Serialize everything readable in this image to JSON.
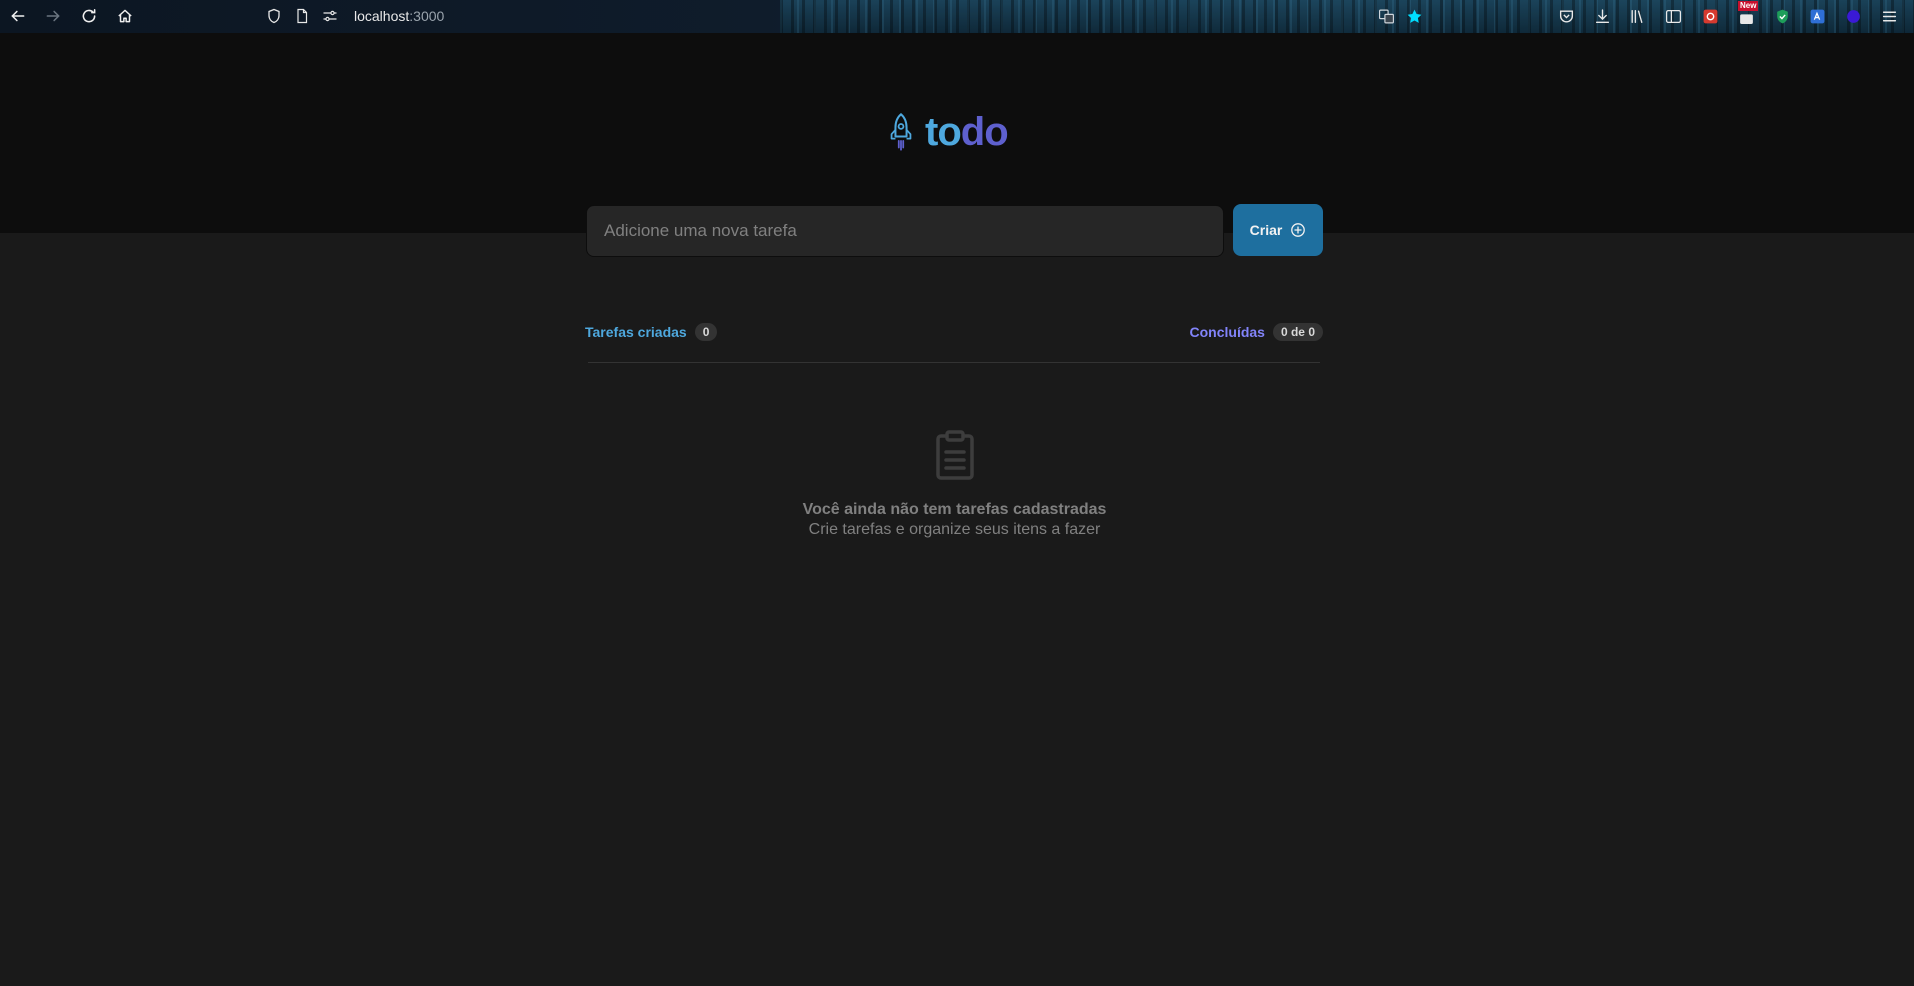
{
  "browser": {
    "url_host": "localhost",
    "url_port": ":3000",
    "badge_new": "New"
  },
  "app": {
    "logo_part1": "to",
    "logo_part2": "do",
    "input_placeholder": "Adicione uma nova tarefa",
    "create_label": "Criar",
    "created_label": "Tarefas criadas",
    "created_count": "0",
    "done_label": "Concluídas",
    "done_count": "0 de 0",
    "empty_title": "Você ainda não tem tarefas cadastradas",
    "empty_subtitle": "Crie tarefas e organize seus itens a fazer"
  },
  "colors": {
    "blue": "#4ea8de",
    "purple": "#5e60ce",
    "purple_light": "#8284fa",
    "button": "#1e6f9f",
    "background": "#1a1a1a",
    "header": "#0d0d0d"
  }
}
